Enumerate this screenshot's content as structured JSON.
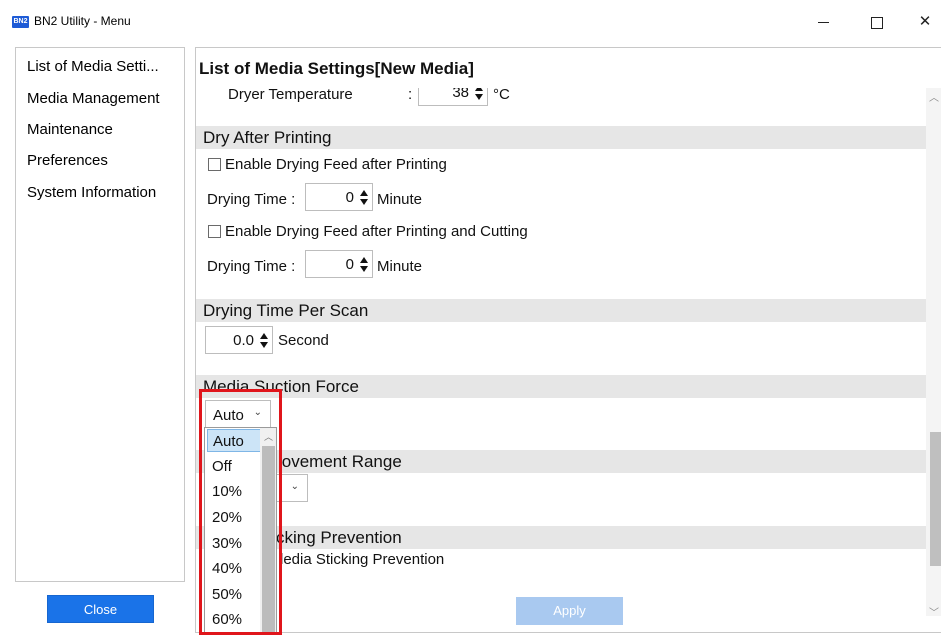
{
  "window": {
    "app_icon_text": "BN2",
    "title": "BN2 Utility - Menu",
    "minimize": "",
    "maximize": "",
    "close": "✕"
  },
  "sidebar": {
    "items": [
      {
        "label": "List of Media Setti..."
      },
      {
        "label": "Media Management"
      },
      {
        "label": "Maintenance"
      },
      {
        "label": "Preferences"
      },
      {
        "label": "System Information"
      }
    ],
    "close_label": "Close"
  },
  "main": {
    "title": "List of Media Settings[New Media]",
    "dryer_temperature": {
      "label": "Dryer Temperature",
      "colon": ":",
      "value": "38",
      "unit": "°C"
    },
    "dry_after_printing": {
      "title": "Dry After Printing",
      "enable_feed_label": "Enable Drying Feed after Printing",
      "enable_feed_checked": false,
      "drying_time_label": "Drying Time :",
      "drying_time_value": "0",
      "drying_time_unit": "Minute",
      "enable_feed_cutting_label": "Enable Drying Feed after Printing and Cutting",
      "enable_feed_cutting_checked": false,
      "drying_time2_label": "Drying Time :",
      "drying_time2_value": "0",
      "drying_time2_unit": "Minute"
    },
    "drying_time_per_scan": {
      "title": "Drying Time Per Scan",
      "value": "0.0",
      "unit": "Second"
    },
    "media_suction_force": {
      "title": "Media Suction Force",
      "selected": "Auto",
      "chevron": "⌄",
      "options": [
        "Auto",
        "Off",
        "10%",
        "20%",
        "30%",
        "40%",
        "50%",
        "60%"
      ]
    },
    "movement_range": {
      "title_visible_part": "lovement Range",
      "chevron": "⌄"
    },
    "sticking_prevention": {
      "title_visible_part": "cking Prevention",
      "checkbox_label_visible_part": "ledia Sticking Prevention"
    },
    "apply_label": "Apply",
    "scroll_up": "︿",
    "scroll_down": "﹀"
  },
  "colors": {
    "primary_button": "#1a73e8",
    "disabled_button": "#a9c9f0",
    "section_bar": "#e6e6e6",
    "highlight": "#e0151b",
    "selected_item": "#cce4f7"
  }
}
